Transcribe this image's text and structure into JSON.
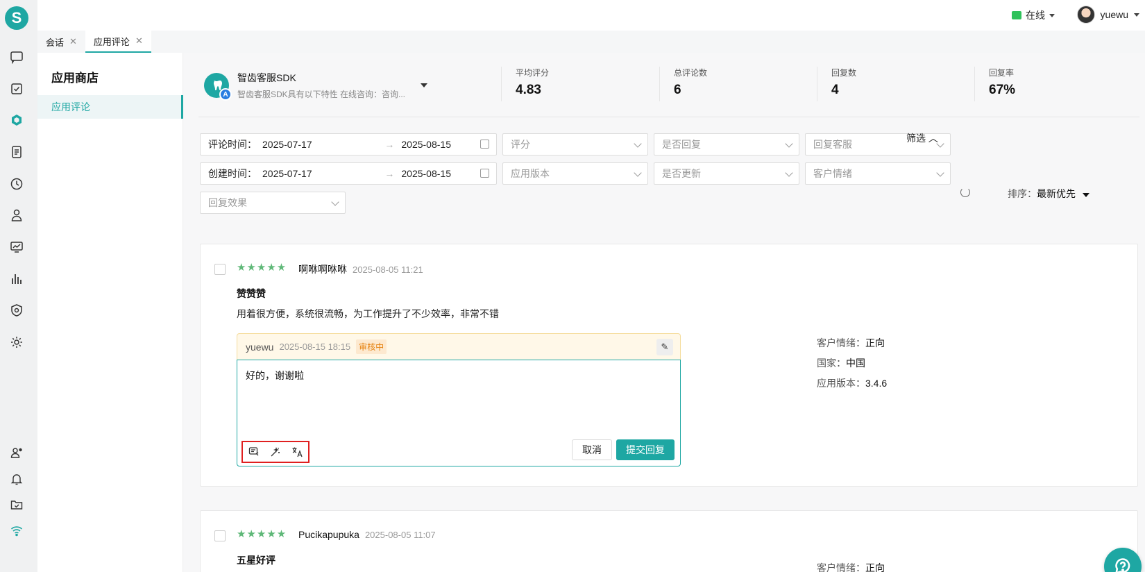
{
  "rail": {
    "logo": "S",
    "icons": [
      "chat-icon",
      "task-check-icon",
      "app-store-icon",
      "document-icon",
      "clock-icon",
      "user-tie-icon",
      "monitor-chart-icon",
      "bar-chart-icon",
      "shield-icon",
      "gear-icon",
      "user-status-icon",
      "bell-icon",
      "folder-check-icon",
      "wifi-icon"
    ]
  },
  "topbar": {
    "status_label": "在线",
    "username": "yuewu"
  },
  "tabs": [
    {
      "label": "会话",
      "active": false
    },
    {
      "label": "应用评论",
      "active": true
    }
  ],
  "subnav": {
    "title": "应用商店",
    "items": [
      {
        "label": "应用评论",
        "active": true
      }
    ]
  },
  "app": {
    "name": "智齿客服SDK",
    "description": "智齿客服SDK具有以下特性 在线咨询：咨询..."
  },
  "stats": [
    {
      "label": "平均评分",
      "value": "4.83"
    },
    {
      "label": "总评论数",
      "value": "6"
    },
    {
      "label": "回复数",
      "value": "4"
    },
    {
      "label": "回复率",
      "value": "67%"
    }
  ],
  "filters": {
    "comment_time": {
      "label": "评论时间：",
      "start": "2025-07-17",
      "arrow": "→",
      "end": "2025-08-15"
    },
    "create_time": {
      "label": "创建时间：",
      "start": "2025-07-17",
      "arrow": "→",
      "end": "2025-08-15"
    },
    "rating_placeholder": "评分",
    "replied_placeholder": "是否回复",
    "reply_agent_placeholder": "回复客服",
    "app_version_placeholder": "应用版本",
    "updated_placeholder": "是否更新",
    "sentiment_placeholder": "客户情绪",
    "reply_effect_placeholder": "回复效果",
    "toggle_label": "筛选 ︿"
  },
  "sort": {
    "label": "排序：",
    "value": "最新优先"
  },
  "reviews": [
    {
      "stars": "★★★★★",
      "rating": 5,
      "author": "啊咻啊咻咻",
      "time": "2025-08-05 11:21",
      "title": "赞赞赞",
      "body": "用着很方便，系统很流畅，为工作提升了不少效率，非常不错",
      "reply": {
        "author": "yuewu",
        "time": "2025-08-15 18:15",
        "status": "审核中",
        "text": "好的，谢谢啦",
        "cancel_label": "取消",
        "submit_label": "提交回复"
      },
      "meta": [
        {
          "label": "客户情绪：",
          "value": "正向"
        },
        {
          "label": "国家：",
          "value": "中国"
        },
        {
          "label": "应用版本：",
          "value": "3.4.6"
        }
      ]
    },
    {
      "stars": "★★★★★",
      "rating": 5,
      "author": "Pucikapupuka",
      "time": "2025-08-05 11:07",
      "title": "五星好评",
      "meta": [
        {
          "label": "客户情绪：",
          "value": "正向"
        }
      ]
    }
  ],
  "colors": {
    "accent": "#1ea7a3",
    "star": "#5fb878",
    "pending": "#e6820f",
    "highlight_box": "#e02020"
  }
}
